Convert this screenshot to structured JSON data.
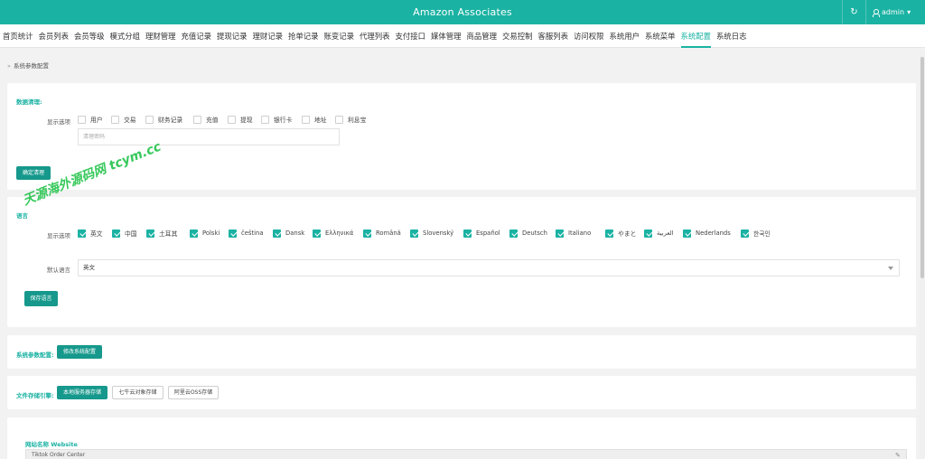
{
  "app": {
    "title": "Amazon Associates",
    "user": "admin"
  },
  "nav": {
    "items": [
      "首页统计",
      "会员列表",
      "会员等级",
      "模式分组",
      "理财管理",
      "充值记录",
      "提现记录",
      "理财记录",
      "抢单记录",
      "账变记录",
      "代理列表",
      "支付接口",
      "媒体管理",
      "商品管理",
      "交易控制",
      "客服列表",
      "访问权限",
      "系统用户",
      "系统菜单",
      "系统配置",
      "系统日志"
    ],
    "active_index": 19
  },
  "breadcrumb": {
    "label": "系统参数配置"
  },
  "data_cleanup": {
    "title": "数据清理:",
    "options_label": "显示选项",
    "options": [
      "用户",
      "交易",
      "财务记录",
      "充值",
      "提现",
      "银行卡",
      "地址",
      "利息宝"
    ],
    "input_placeholder": "清理密码",
    "confirm_button": "确定清理"
  },
  "language": {
    "title": "语言",
    "options_label": "显示选项",
    "options": [
      "英文",
      "中国",
      "土耳其",
      "Polski",
      "čeština",
      "Dansk",
      "Ελληνικά",
      "Română",
      "Slovenský",
      "Español",
      "Deutsch",
      "Italiano",
      "やまと",
      "العربية",
      "Nederlands",
      "한국인"
    ],
    "default_label": "默认语言",
    "default_value": "英文",
    "save_button": "保存语言"
  },
  "system_params": {
    "title": "系统参数配置:",
    "edit_button": "修改系统配置"
  },
  "file_storage": {
    "title": "文件存储引擎:",
    "buttons": [
      "本地服务器存储",
      "七牛云对象存储",
      "阿里云OSS存储"
    ],
    "active_index": 0
  },
  "website": {
    "label": "网站名称 Website",
    "value": "Tiktok  Order Center"
  },
  "watermark": {
    "text": "天源海外源码网 tcym.cc"
  },
  "colors": {
    "accent": "#1ab2a3",
    "button": "#16998c",
    "watermark": "#22c34a"
  }
}
